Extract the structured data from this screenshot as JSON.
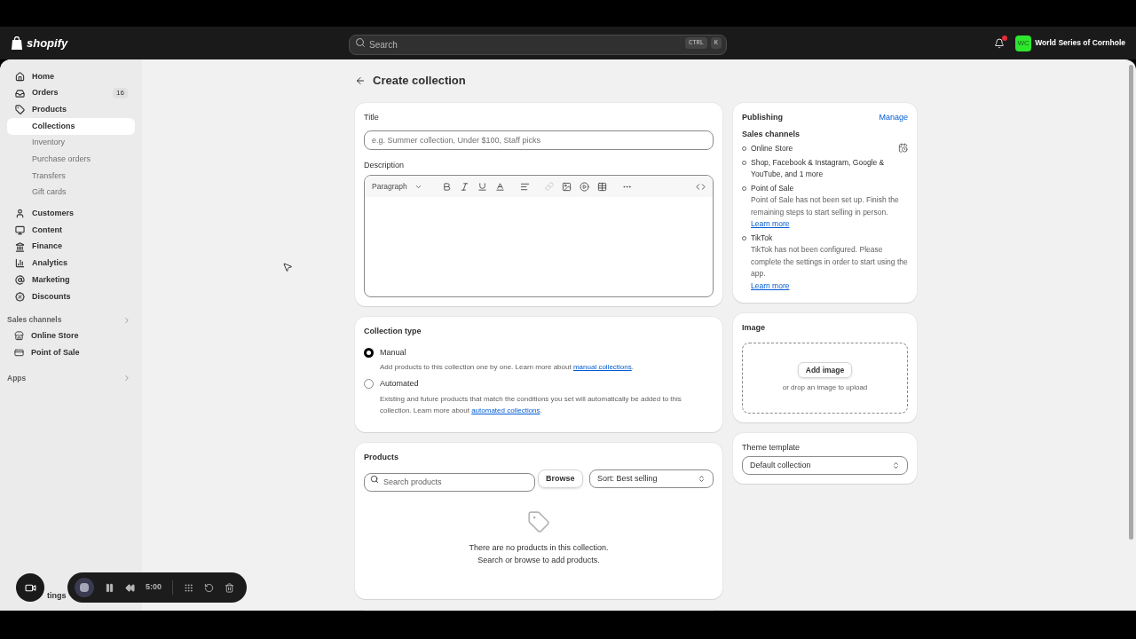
{
  "topbar": {
    "logo": "shopify",
    "search": {
      "placeholder": "Search",
      "keys": [
        "CTRL",
        "K"
      ]
    },
    "store": {
      "initials": "WC",
      "name": "World Series of Cornhole",
      "color": "#2ee62e"
    }
  },
  "sidebar": {
    "items": [
      {
        "label": "Home",
        "kind": "main",
        "selected": false
      },
      {
        "label": "Orders",
        "kind": "main",
        "selected": false,
        "badge": "16"
      },
      {
        "label": "Products",
        "kind": "main",
        "selected": false
      },
      {
        "label": "Collections",
        "kind": "sub",
        "selected": true
      },
      {
        "label": "Inventory",
        "kind": "sub",
        "selected": false
      },
      {
        "label": "Purchase orders",
        "kind": "sub",
        "selected": false
      },
      {
        "label": "Transfers",
        "kind": "sub",
        "selected": false
      },
      {
        "label": "Gift cards",
        "kind": "sub",
        "selected": false
      },
      {
        "label": "Customers",
        "kind": "main",
        "selected": false
      },
      {
        "label": "Content",
        "kind": "main",
        "selected": false
      },
      {
        "label": "Finance",
        "kind": "main",
        "selected": false
      },
      {
        "label": "Analytics",
        "kind": "main",
        "selected": false
      },
      {
        "label": "Marketing",
        "kind": "main",
        "selected": false
      },
      {
        "label": "Discounts",
        "kind": "main",
        "selected": false
      }
    ],
    "sales_channels": {
      "heading": "Sales channels",
      "items": [
        {
          "label": "Online Store"
        },
        {
          "label": "Point of Sale"
        }
      ]
    },
    "apps": {
      "heading": "Apps"
    },
    "settings": {
      "label": "tings"
    }
  },
  "page": {
    "title": "Create collection",
    "details": {
      "title_label": "Title",
      "title_placeholder": "e.g. Summer collection, Under $100, Staff picks",
      "description_label": "Description",
      "paragraph": "Paragraph"
    },
    "collection_type": {
      "heading": "Collection type",
      "options": [
        {
          "label": "Manual",
          "selected": true,
          "text": "Add products to this collection one by one. Learn more about ",
          "link": "manual collections",
          "after": "."
        },
        {
          "label": "Automated",
          "selected": false,
          "text": "Existing and future products that match the conditions you set will automatically be added to this collection. Learn more about ",
          "link": "automated collections",
          "after": "."
        }
      ]
    },
    "products": {
      "heading": "Products",
      "search_placeholder": "Search products",
      "browse": "Browse",
      "sort": "Sort: Best selling",
      "empty": [
        "There are no products in this collection.",
        "Search or browse to add products."
      ]
    },
    "publishing": {
      "heading": "Publishing",
      "manage": "Manage",
      "subheading": "Sales channels",
      "channels": [
        {
          "name": "Online Store"
        },
        {
          "name": "Shop, Facebook & Instagram, Google & YouTube, and 1 more"
        },
        {
          "name": "Point of Sale",
          "note": "Point of Sale has not been set up. Finish the remaining steps to start selling in person.",
          "link": "Learn more"
        },
        {
          "name": "TikTok",
          "note": "TikTok has not been configured. Please complete the settings in order to start using the app.",
          "link": "Learn more"
        }
      ]
    },
    "image": {
      "heading": "Image",
      "button": "Add image",
      "hint": "or drop an image to upload"
    },
    "theme": {
      "label": "Theme template",
      "value": "Default collection"
    }
  },
  "recorder": {
    "time": "5:00"
  }
}
